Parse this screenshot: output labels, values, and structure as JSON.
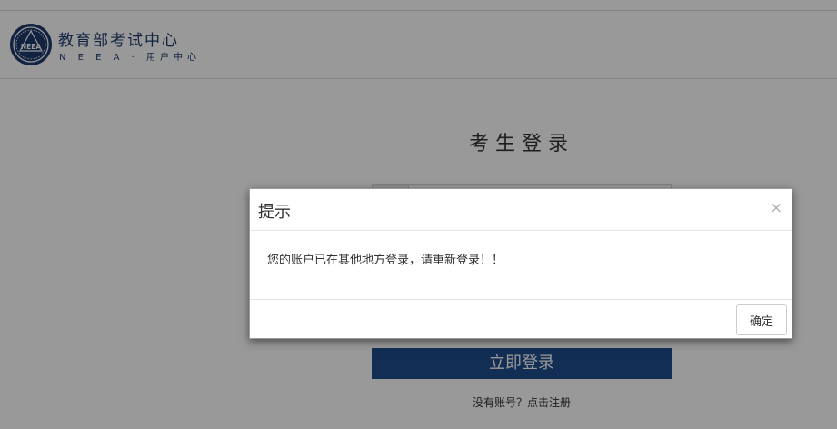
{
  "header": {
    "title": "教育部考试中心",
    "subtitle": "N E E A · 用户中心",
    "logo_text": "NEEA"
  },
  "login": {
    "title": "考生登录",
    "submit_label": "立即登录",
    "register_text": "没有账号？点击注册"
  },
  "modal": {
    "title": "提示",
    "close_glyph": "×",
    "message": "您的账户已在其他地方登录，请重新登录！！",
    "confirm_label": "确定"
  },
  "colors": {
    "brand": "#1e3a6d",
    "login_button": "#1f4e8c",
    "overlay": "rgba(0,0,0,0.4)"
  }
}
